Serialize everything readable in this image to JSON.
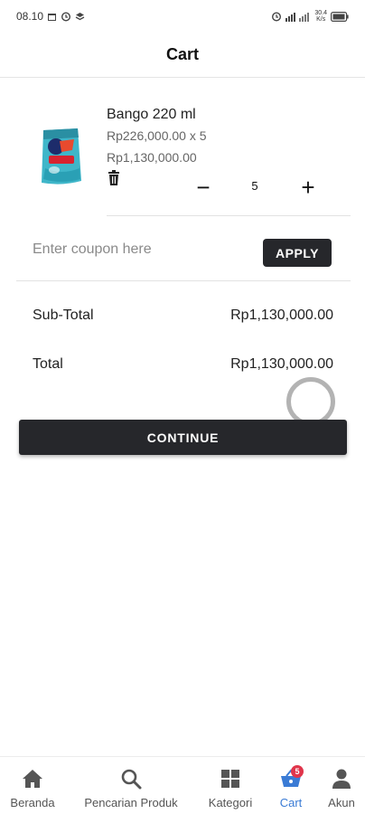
{
  "status_bar": {
    "time": "08.10",
    "net_speed_top": "30.4",
    "net_speed_bottom": "K/s"
  },
  "app_bar": {
    "title": "Cart"
  },
  "cart": {
    "items": [
      {
        "name": "Bango 220 ml",
        "price_qty": "Rp226,000.00 x 5",
        "subtotal": "Rp1,130,000.00",
        "quantity": "5",
        "minus_symbol": "−",
        "plus_symbol": "+",
        "image_icon": "product-pouch-icon"
      }
    ]
  },
  "coupon": {
    "placeholder": "Enter coupon here",
    "value": "",
    "apply_label": "APPLY"
  },
  "summary": {
    "subtotal_label": "Sub-Total",
    "subtotal_value": "Rp1,130,000.00",
    "total_label": "Total",
    "total_value": "Rp1,130,000.00"
  },
  "continue_label": "CONTINUE",
  "colors": {
    "button_dark": "#26272b",
    "nav_active": "#3a7bd5",
    "badge": "#e0354b"
  },
  "bottom_nav": {
    "items": [
      {
        "label": "Beranda",
        "icon": "home-icon",
        "active": false
      },
      {
        "label": "Pencarian Produk",
        "icon": "search-icon",
        "active": false
      },
      {
        "label": "Kategori",
        "icon": "grid-icon",
        "active": false
      },
      {
        "label": "Cart",
        "icon": "basket-icon",
        "active": true,
        "badge": "5"
      },
      {
        "label": "Akun",
        "icon": "person-icon",
        "active": false
      }
    ]
  }
}
